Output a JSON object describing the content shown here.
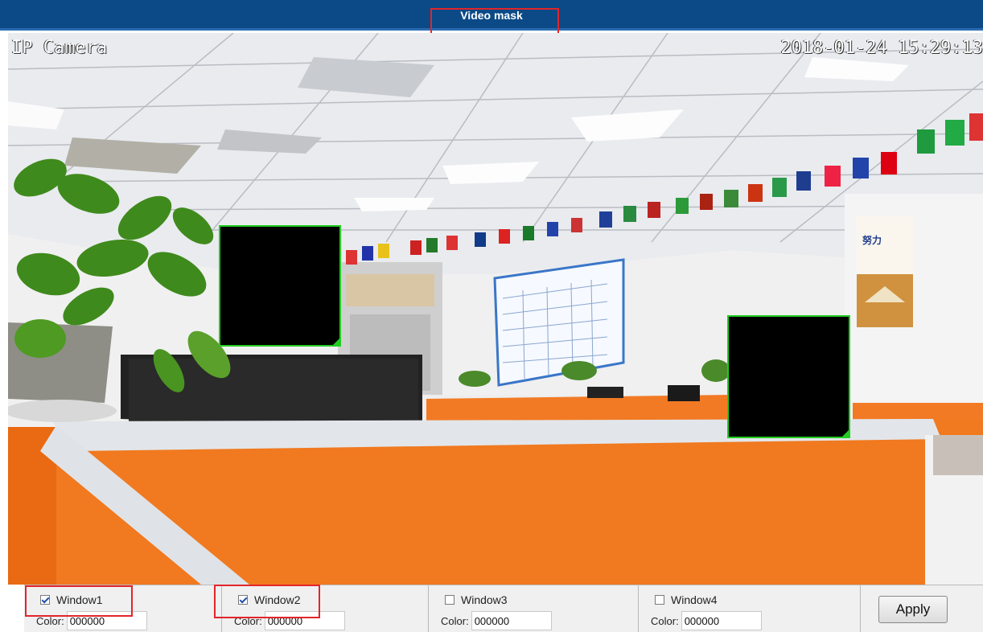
{
  "header": {
    "title": "Video mask"
  },
  "video": {
    "osd_label": "IP Camera",
    "osd_timestamp": "2018-01-24 15:29:13",
    "poster_text": "努力"
  },
  "windows": [
    {
      "label": "Window1",
      "checked": true,
      "color_label": "Color:",
      "color_value": "000000"
    },
    {
      "label": "Window2",
      "checked": true,
      "color_label": "Color:",
      "color_value": "000000"
    },
    {
      "label": "Window3",
      "checked": false,
      "color_label": "Color:",
      "color_value": "000000"
    },
    {
      "label": "Window4",
      "checked": false,
      "color_label": "Color:",
      "color_value": "000000"
    }
  ],
  "apply_label": "Apply",
  "colors": {
    "header_bg": "#0b4a86",
    "mask_border": "#22cc22",
    "highlight": "#e2252b",
    "mask_fill": "#000000"
  }
}
